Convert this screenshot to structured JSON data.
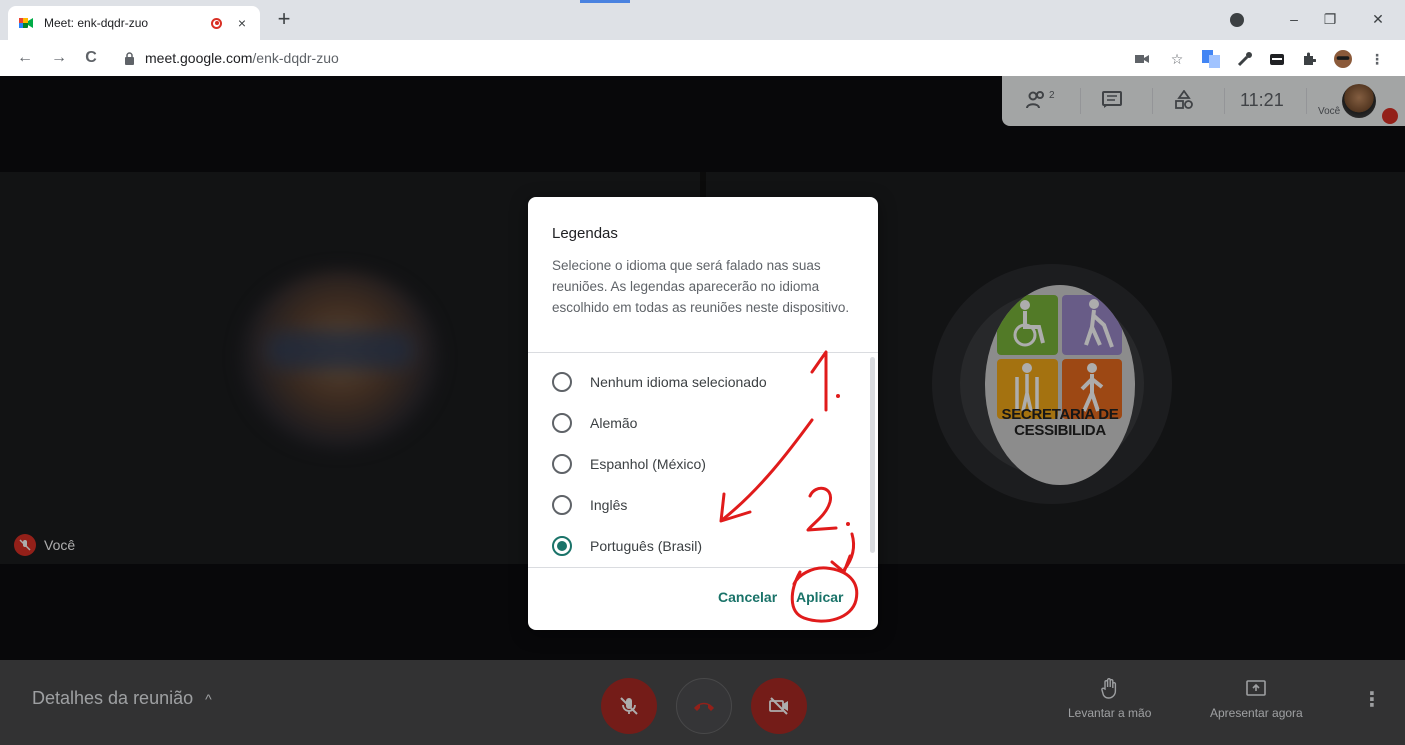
{
  "browser": {
    "tab_title": "Meet: enk-dqdr-zuo",
    "tab_close": "×",
    "new_tab": "+",
    "url_host": "meet.google.com",
    "url_path": "/enk-dqdr-zuo",
    "controls": {
      "minimize": "–",
      "restore": "❐",
      "close": "✕"
    },
    "nav": {
      "back": "←",
      "forward": "→",
      "reload": "C"
    }
  },
  "meeting": {
    "clock": "11:21",
    "self_label": "Você",
    "participant_count": "2",
    "self_tile_name": "Você",
    "logo_text_line1": "SECRETARIA DE",
    "logo_text_line2": "CESSIBILIDA"
  },
  "bottom_bar": {
    "details_label": "Detalhes da reunião",
    "caret": "^",
    "raise_hand_label": "Levantar a mão",
    "present_label": "Apresentar agora",
    "more": "⋮"
  },
  "dialog": {
    "title": "Legendas",
    "description": "Selecione o idioma que será falado nas suas reuniões. As legendas aparecerão no idioma escolhido em todas as reuniões neste dispositivo.",
    "options": [
      {
        "label": "Nenhum idioma selecionado",
        "selected": false
      },
      {
        "label": "Alemão",
        "selected": false
      },
      {
        "label": "Espanhol (México)",
        "selected": false
      },
      {
        "label": "Inglês",
        "selected": false
      },
      {
        "label": "Português (Brasil)",
        "selected": true
      }
    ],
    "cancel_label": "Cancelar",
    "apply_label": "Aplicar"
  },
  "annotations": {
    "step1": "1.",
    "step2": "2."
  },
  "colors": {
    "accent": "#1a7369",
    "danger": "#d93025",
    "annotation": "#e01b1b"
  }
}
